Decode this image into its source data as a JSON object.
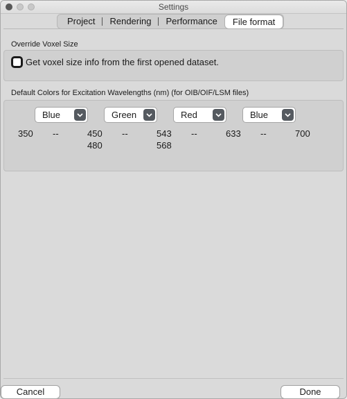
{
  "window": {
    "title": "Settings"
  },
  "tabs": [
    {
      "label": "Project"
    },
    {
      "label": "Rendering"
    },
    {
      "label": "Performance"
    },
    {
      "label": "File format",
      "active": true
    }
  ],
  "voxel": {
    "section_title": "Override Voxel Size",
    "checkbox_label": "Get voxel size info from the first opened dataset.",
    "checked": false
  },
  "colors": {
    "section_title": "Default Colors for Excitation Wavelengths (nm) (for OIB/OIF/LSM files)",
    "selects": [
      {
        "value": "Blue"
      },
      {
        "value": "Green"
      },
      {
        "value": "Red"
      },
      {
        "value": "Blue"
      }
    ],
    "wavelengths": {
      "w1": "350",
      "sep1": "--",
      "w2": "450",
      "w2b": "480",
      "sep2": "--",
      "w3": "543",
      "w3b": "568",
      "sep3": "--",
      "w4": "633",
      "sep4": "--",
      "w5": "700"
    }
  },
  "footer": {
    "cancel_label": "Cancel",
    "done_label": "Done"
  }
}
